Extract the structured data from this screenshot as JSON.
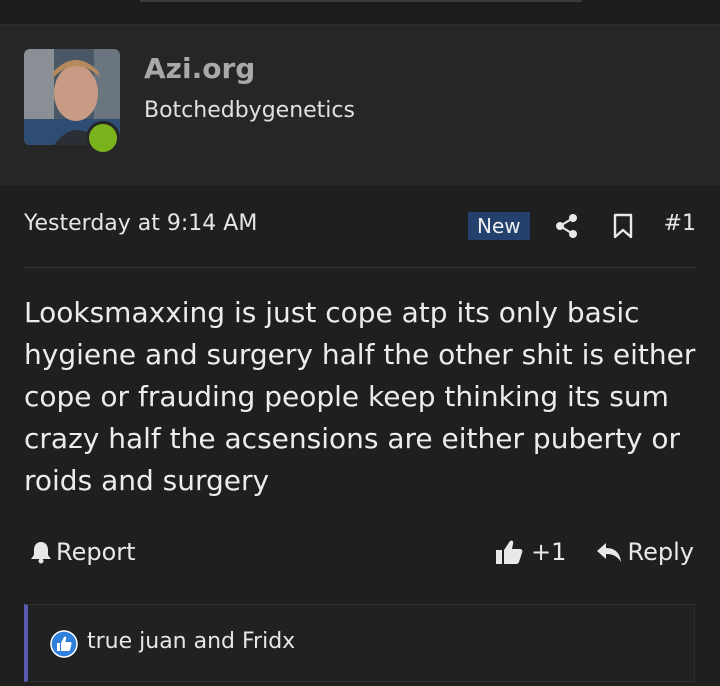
{
  "user": {
    "name": "Azi.org",
    "title": "Botchedbygenetics",
    "online": true,
    "status_color": "#7ab31b"
  },
  "post": {
    "timestamp": "Yesterday at 9:14 AM",
    "badge": "New",
    "number": "#1",
    "body": "Looksmaxxing is just cope atp its only basic hygiene and surgery half the other shit is either cope or frauding people keep thinking its sum crazy half the acsensions are either puberty or roids and surgery"
  },
  "actions": {
    "report_label": "Report",
    "like_count": "+1",
    "reply_label": "Reply"
  },
  "reactions": {
    "text": "true juan and Fridx",
    "icon": "like-icon"
  },
  "colors": {
    "background": "#1f1f1f",
    "panel": "#262626",
    "badge": "#24406c",
    "reaction_accent": "#5a5bb0",
    "like_blue": "#2f7fdc"
  }
}
